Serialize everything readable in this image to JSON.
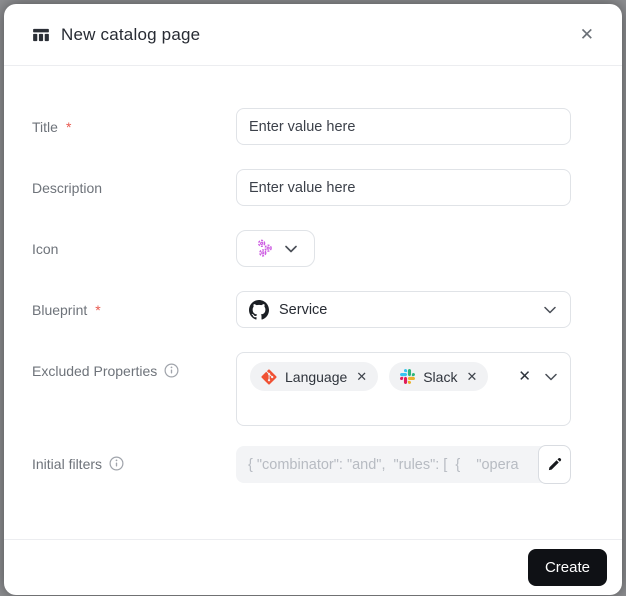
{
  "dialog": {
    "title": "New catalog page"
  },
  "icons": {
    "close_glyph": "✕",
    "chip_close_glyph": "✕",
    "clear_glyph": "✕"
  },
  "form": {
    "title": {
      "label": "Title",
      "required_mark": "*",
      "placeholder": "Enter value here",
      "value": ""
    },
    "description": {
      "label": "Description",
      "placeholder": "Enter value here",
      "value": ""
    },
    "icon": {
      "label": "Icon",
      "selected_icon": "microservices-icon"
    },
    "blueprint": {
      "label": "Blueprint",
      "required_mark": "*",
      "selected_value": "Service",
      "selected_icon": "github-icon"
    },
    "excluded_properties": {
      "label": "Excluded Properties",
      "chips": [
        {
          "label": "Language",
          "icon": "git-icon"
        },
        {
          "label": "Slack",
          "icon": "slack-icon"
        }
      ]
    },
    "initial_filters": {
      "label": "Initial filters",
      "value": "{ \"combinator\": \"and\",  \"rules\": [  {    \"opera"
    }
  },
  "footer": {
    "create_label": "Create"
  },
  "colors": {
    "accent_purple": "#cd5ce2",
    "git_orange": "#f05133",
    "required_red": "#e8594f",
    "button_black": "#0f1115",
    "slack_blue": "#36C5F0",
    "slack_green": "#2EB67D",
    "slack_yellow": "#ECB22E",
    "slack_pink": "#E01E5A"
  }
}
